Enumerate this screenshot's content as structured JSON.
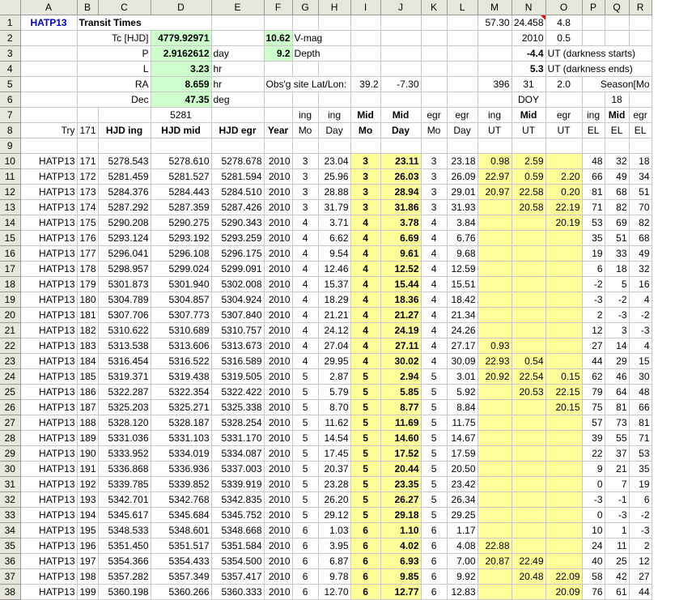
{
  "columns": [
    "A",
    "B",
    "C",
    "D",
    "E",
    "F",
    "G",
    "H",
    "I",
    "J",
    "K",
    "L",
    "M",
    "N",
    "O",
    "P",
    "Q",
    "R"
  ],
  "row_numbers": [
    1,
    2,
    3,
    4,
    5,
    6,
    7,
    8,
    9,
    10,
    11,
    12,
    13,
    14,
    15,
    16,
    17,
    18,
    19,
    20,
    21,
    22,
    23,
    24,
    25,
    26,
    27,
    28,
    29,
    30,
    31,
    32,
    33,
    34,
    35,
    36,
    37,
    38
  ],
  "top": {
    "a1": "HATP13",
    "b1": "Transit Times",
    "m1": "57.30",
    "n1": "24.458",
    "o1": "4.8",
    "n2": "2010",
    "o2": "0.5",
    "n3": "-4.4",
    "o3": "UT (darkness starts)",
    "n4": "5.3",
    "o4": "UT (darkness ends)",
    "c2": "Tc [HJD]",
    "d2": "4779.92971",
    "f2": "10.62",
    "g2": "V-mag",
    "c3": "P",
    "d3": "2.9162612",
    "e3": "day",
    "f3": "9.2",
    "g3": "Depth",
    "c4": "L",
    "d4": "3.23",
    "e4": "hr",
    "c5": "RA",
    "d5": "8.659",
    "e5": "hr",
    "f5": "Obs'g site Lat/Lon:",
    "h5": "39.2",
    "i5": "-7.30",
    "m5": "396",
    "n5": "31",
    "o5": "2.0",
    "p5": "Season[Mo",
    "c6": "Dec",
    "d6": "47.35",
    "e6": "deg",
    "n6": "DOY",
    "q6": "18",
    "d7": "5281"
  },
  "headers": {
    "g_1": "ing",
    "g_2": "Mo",
    "h_1": "ing",
    "h_2": "Day",
    "i_1": "Mid",
    "i_2": "Mo",
    "j_1": "Mid",
    "j_2": "Day",
    "k_1": "egr",
    "k_2": "Mo",
    "l_1": "egr",
    "l_2": "Day",
    "m_1": "ing",
    "m_2": "UT",
    "n_1": "Mid",
    "n_2": "UT",
    "o_1": "egr",
    "o_2": "UT",
    "p_1": "ing",
    "p_2": "EL",
    "q_1": "Mid",
    "q_2": "EL",
    "r_1": "egr",
    "r_2": "EL",
    "a8": "Try",
    "b8": "171",
    "c8": "HJD ing",
    "d8": "HJD mid",
    "e8": "HJD egr",
    "f8": "Year"
  },
  "rows": [
    [
      "HATP13",
      "171",
      "5278.543",
      "5278.610",
      "5278.678",
      "2010",
      "3",
      "23.04",
      "3",
      "23.11",
      "3",
      "23.18",
      "0.98",
      "2.59",
      "",
      "48",
      "32",
      "18"
    ],
    [
      "HATP13",
      "172",
      "5281.459",
      "5281.527",
      "5281.594",
      "2010",
      "3",
      "25.96",
      "3",
      "26.03",
      "3",
      "26.09",
      "22.97",
      "0.59",
      "2.20",
      "66",
      "49",
      "34"
    ],
    [
      "HATP13",
      "173",
      "5284.376",
      "5284.443",
      "5284.510",
      "2010",
      "3",
      "28.88",
      "3",
      "28.94",
      "3",
      "29.01",
      "20.97",
      "22.58",
      "0.20",
      "81",
      "68",
      "51"
    ],
    [
      "HATP13",
      "174",
      "5287.292",
      "5287.359",
      "5287.426",
      "2010",
      "3",
      "31.79",
      "3",
      "31.86",
      "3",
      "31.93",
      "",
      "20.58",
      "22.19",
      "71",
      "82",
      "70"
    ],
    [
      "HATP13",
      "175",
      "5290.208",
      "5290.275",
      "5290.343",
      "2010",
      "4",
      "3.71",
      "4",
      "3.78",
      "4",
      "3.84",
      "",
      "",
      "20.19",
      "53",
      "69",
      "82"
    ],
    [
      "HATP13",
      "176",
      "5293.124",
      "5293.192",
      "5293.259",
      "2010",
      "4",
      "6.62",
      "4",
      "6.69",
      "4",
      "6.76",
      "",
      "",
      "",
      "35",
      "51",
      "68"
    ],
    [
      "HATP13",
      "177",
      "5296.041",
      "5296.108",
      "5296.175",
      "2010",
      "4",
      "9.54",
      "4",
      "9.61",
      "4",
      "9.68",
      "",
      "",
      "",
      "19",
      "33",
      "49"
    ],
    [
      "HATP13",
      "178",
      "5298.957",
      "5299.024",
      "5299.091",
      "2010",
      "4",
      "12.46",
      "4",
      "12.52",
      "4",
      "12.59",
      "",
      "",
      "",
      "6",
      "18",
      "32"
    ],
    [
      "HATP13",
      "179",
      "5301.873",
      "5301.940",
      "5302.008",
      "2010",
      "4",
      "15.37",
      "4",
      "15.44",
      "4",
      "15.51",
      "",
      "",
      "",
      "-2",
      "5",
      "16"
    ],
    [
      "HATP13",
      "180",
      "5304.789",
      "5304.857",
      "5304.924",
      "2010",
      "4",
      "18.29",
      "4",
      "18.36",
      "4",
      "18.42",
      "",
      "",
      "",
      "-3",
      "-2",
      "4"
    ],
    [
      "HATP13",
      "181",
      "5307.706",
      "5307.773",
      "5307.840",
      "2010",
      "4",
      "21.21",
      "4",
      "21.27",
      "4",
      "21.34",
      "",
      "",
      "",
      "2",
      "-3",
      "-2"
    ],
    [
      "HATP13",
      "182",
      "5310.622",
      "5310.689",
      "5310.757",
      "2010",
      "4",
      "24.12",
      "4",
      "24.19",
      "4",
      "24.26",
      "",
      "",
      "",
      "12",
      "3",
      "-3"
    ],
    [
      "HATP13",
      "183",
      "5313.538",
      "5313.606",
      "5313.673",
      "2010",
      "4",
      "27.04",
      "4",
      "27.11",
      "4",
      "27.17",
      "0.93",
      "",
      "",
      "27",
      "14",
      "4"
    ],
    [
      "HATP13",
      "184",
      "5316.454",
      "5316.522",
      "5316.589",
      "2010",
      "4",
      "29.95",
      "4",
      "30.02",
      "4",
      "30.09",
      "22.93",
      "0.54",
      "",
      "44",
      "29",
      "15"
    ],
    [
      "HATP13",
      "185",
      "5319.371",
      "5319.438",
      "5319.505",
      "2010",
      "5",
      "2.87",
      "5",
      "2.94",
      "5",
      "3.01",
      "20.92",
      "22.54",
      "0.15",
      "62",
      "46",
      "30"
    ],
    [
      "HATP13",
      "186",
      "5322.287",
      "5322.354",
      "5322.422",
      "2010",
      "5",
      "5.79",
      "5",
      "5.85",
      "5",
      "5.92",
      "",
      "20.53",
      "22.15",
      "79",
      "64",
      "48"
    ],
    [
      "HATP13",
      "187",
      "5325.203",
      "5325.271",
      "5325.338",
      "2010",
      "5",
      "8.70",
      "5",
      "8.77",
      "5",
      "8.84",
      "",
      "",
      "20.15",
      "75",
      "81",
      "66"
    ],
    [
      "HATP13",
      "188",
      "5328.120",
      "5328.187",
      "5328.254",
      "2010",
      "5",
      "11.62",
      "5",
      "11.69",
      "5",
      "11.75",
      "",
      "",
      "",
      "57",
      "73",
      "81"
    ],
    [
      "HATP13",
      "189",
      "5331.036",
      "5331.103",
      "5331.170",
      "2010",
      "5",
      "14.54",
      "5",
      "14.60",
      "5",
      "14.67",
      "",
      "",
      "",
      "39",
      "55",
      "71"
    ],
    [
      "HATP13",
      "190",
      "5333.952",
      "5334.019",
      "5334.087",
      "2010",
      "5",
      "17.45",
      "5",
      "17.52",
      "5",
      "17.59",
      "",
      "",
      "",
      "22",
      "37",
      "53"
    ],
    [
      "HATP13",
      "191",
      "5336.868",
      "5336.936",
      "5337.003",
      "2010",
      "5",
      "20.37",
      "5",
      "20.44",
      "5",
      "20.50",
      "",
      "",
      "",
      "9",
      "21",
      "35"
    ],
    [
      "HATP13",
      "192",
      "5339.785",
      "5339.852",
      "5339.919",
      "2010",
      "5",
      "23.28",
      "5",
      "23.35",
      "5",
      "23.42",
      "",
      "",
      "",
      "0",
      "7",
      "19"
    ],
    [
      "HATP13",
      "193",
      "5342.701",
      "5342.768",
      "5342.835",
      "2010",
      "5",
      "26.20",
      "5",
      "26.27",
      "5",
      "26.34",
      "",
      "",
      "",
      "-3",
      "-1",
      "6"
    ],
    [
      "HATP13",
      "194",
      "5345.617",
      "5345.684",
      "5345.752",
      "2010",
      "5",
      "29.12",
      "5",
      "29.18",
      "5",
      "29.25",
      "",
      "",
      "",
      "0",
      "-3",
      "-2"
    ],
    [
      "HATP13",
      "195",
      "5348.533",
      "5348.601",
      "5348.668",
      "2010",
      "6",
      "1.03",
      "6",
      "1.10",
      "6",
      "1.17",
      "",
      "",
      "",
      "10",
      "1",
      "-3"
    ],
    [
      "HATP13",
      "196",
      "5351.450",
      "5351.517",
      "5351.584",
      "2010",
      "6",
      "3.95",
      "6",
      "4.02",
      "6",
      "4.08",
      "22.88",
      "",
      "",
      "24",
      "11",
      "2"
    ],
    [
      "HATP13",
      "197",
      "5354.366",
      "5354.433",
      "5354.500",
      "2010",
      "6",
      "6.87",
      "6",
      "6.93",
      "6",
      "7.00",
      "20.87",
      "22.49",
      "",
      "40",
      "25",
      "12"
    ],
    [
      "HATP13",
      "198",
      "5357.282",
      "5357.349",
      "5357.417",
      "2010",
      "6",
      "9.78",
      "6",
      "9.85",
      "6",
      "9.92",
      "",
      "20.48",
      "22.09",
      "58",
      "42",
      "27"
    ],
    [
      "HATP13",
      "199",
      "5360.198",
      "5360.266",
      "5360.333",
      "2010",
      "6",
      "12.70",
      "6",
      "12.77",
      "6",
      "12.83",
      "",
      "",
      "20.09",
      "76",
      "61",
      "44"
    ]
  ]
}
